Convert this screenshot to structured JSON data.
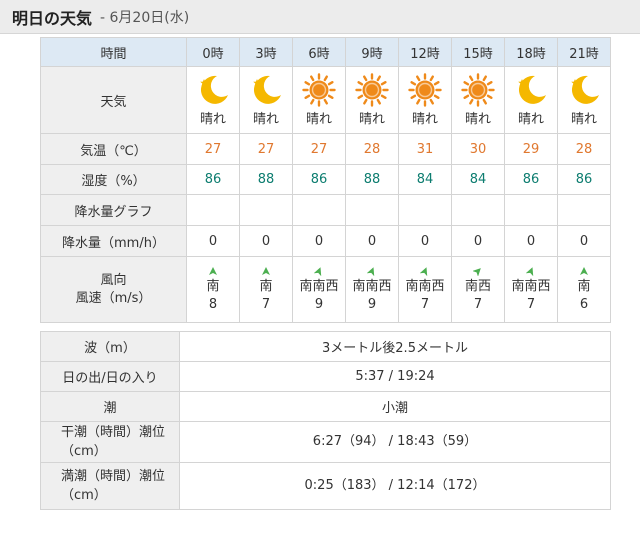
{
  "header": {
    "title": "明日の天気",
    "date": "- 6月20日(水)"
  },
  "forecast": {
    "labels": {
      "time": "時間",
      "weather": "天気",
      "temp": "気温（℃）",
      "humidity": "湿度（%）",
      "precip_graph": "降水量グラフ",
      "precip": "降水量（mm/h）",
      "wind_dir": "風向",
      "wind_speed": "風速（m/s）"
    },
    "hours": [
      {
        "time": "0時",
        "icon": "moon-icon",
        "weather": "晴れ",
        "temp": "27",
        "humidity": "86",
        "precip": "0",
        "wind_dir": "南",
        "wind_speed": "8"
      },
      {
        "time": "3時",
        "icon": "moon-icon",
        "weather": "晴れ",
        "temp": "27",
        "humidity": "88",
        "precip": "0",
        "wind_dir": "南",
        "wind_speed": "7"
      },
      {
        "time": "6時",
        "icon": "sun-icon",
        "weather": "晴れ",
        "temp": "27",
        "humidity": "86",
        "precip": "0",
        "wind_dir": "南南西",
        "wind_speed": "9"
      },
      {
        "time": "9時",
        "icon": "sun-icon",
        "weather": "晴れ",
        "temp": "28",
        "humidity": "88",
        "precip": "0",
        "wind_dir": "南南西",
        "wind_speed": "9"
      },
      {
        "time": "12時",
        "icon": "sun-icon",
        "weather": "晴れ",
        "temp": "31",
        "humidity": "84",
        "precip": "0",
        "wind_dir": "南南西",
        "wind_speed": "7"
      },
      {
        "time": "15時",
        "icon": "sun-icon",
        "weather": "晴れ",
        "temp": "30",
        "humidity": "84",
        "precip": "0",
        "wind_dir": "南西",
        "wind_speed": "7"
      },
      {
        "time": "18時",
        "icon": "moon-icon",
        "weather": "晴れ",
        "temp": "29",
        "humidity": "86",
        "precip": "0",
        "wind_dir": "南南西",
        "wind_speed": "7"
      },
      {
        "time": "21時",
        "icon": "moon-icon",
        "weather": "晴れ",
        "temp": "28",
        "humidity": "86",
        "precip": "0",
        "wind_dir": "南",
        "wind_speed": "6"
      }
    ]
  },
  "extra": {
    "wave_label": "波（m）",
    "wave_value": "3メートル後2.5メートル",
    "sun_label": "日の出/日の入り",
    "sun_value": "5:37 / 19:24",
    "tide_label": "潮",
    "tide_value": "小潮",
    "low_tide_label_1": "干潮（時間）潮位",
    "low_tide_label_2": "（cm）",
    "low_tide_value": "6:27（94） / 18:43（59）",
    "high_tide_label_1": "満潮（時間）潮位",
    "high_tide_label_2": "（cm）",
    "high_tide_value": "0:25（183） / 12:14（172）"
  },
  "colors": {
    "header_bg": "#ececec",
    "hour_header_bg": "#dde9f4",
    "label_bg": "#efefef",
    "temp": "#e0782f",
    "humidity": "#0d7d70",
    "sun": "#ef8a1a",
    "moon": "#f5b800",
    "wind_arrow": "#4caf50"
  }
}
